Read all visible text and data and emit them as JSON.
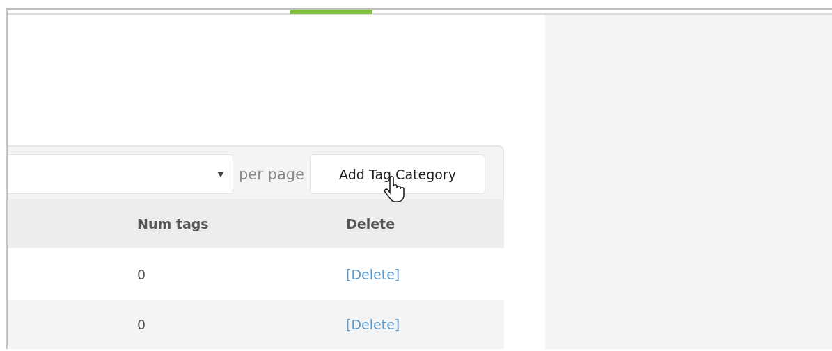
{
  "toolbar": {
    "per_page_label": "per page",
    "add_button": "Add Tag Category"
  },
  "table": {
    "columns": [
      "Num tags",
      "Delete"
    ],
    "rows": [
      {
        "num_tags": "0",
        "delete_link": "[Delete]"
      },
      {
        "num_tags": "0",
        "delete_link": "[Delete]"
      }
    ]
  }
}
